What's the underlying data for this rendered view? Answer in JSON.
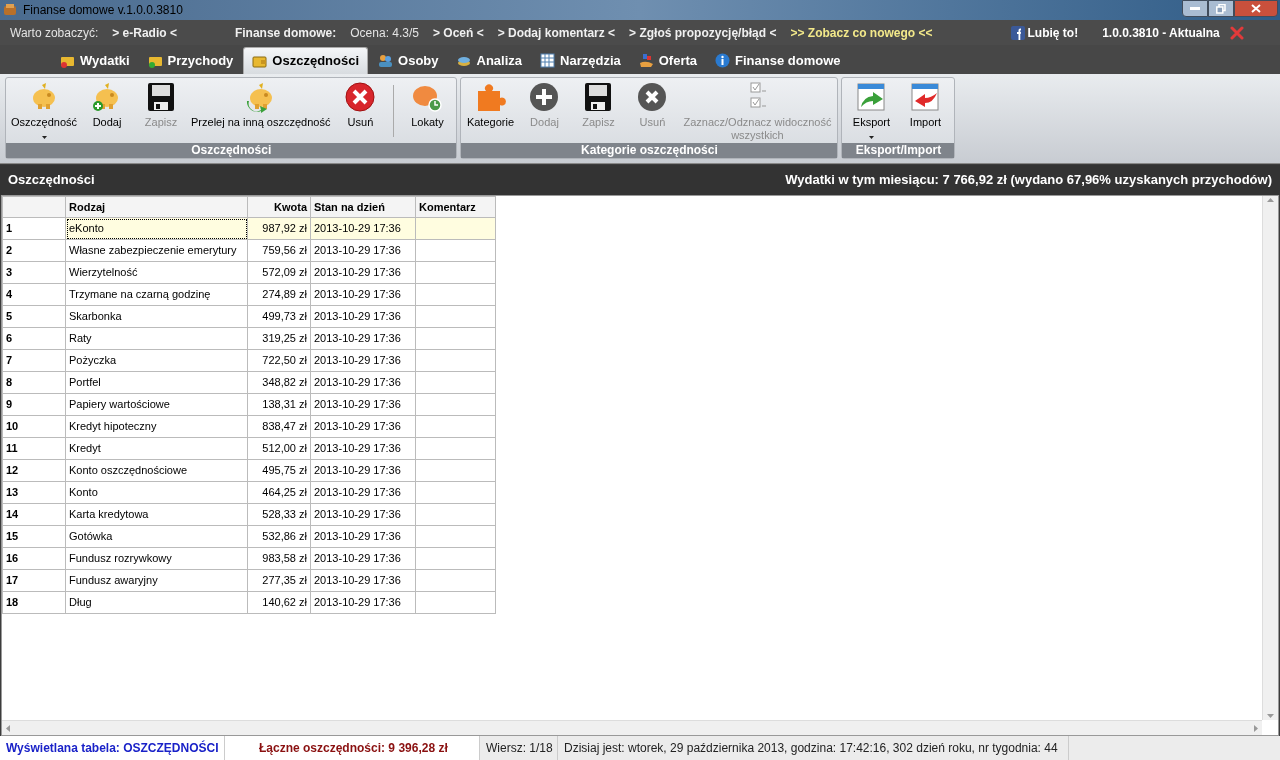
{
  "window": {
    "title": "Finanse domowe v.1.0.0.3810"
  },
  "info_bar": [
    {
      "kind": "label",
      "text": "Warto zobaczyć:"
    },
    {
      "kind": "link",
      "text": "> e-Radio <"
    },
    {
      "kind": "gap"
    },
    {
      "kind": "heading",
      "text": "Finanse domowe:"
    },
    {
      "kind": "label",
      "text": "Ocena: 4.3/5"
    },
    {
      "kind": "link",
      "text": "> Oceń <"
    },
    {
      "kind": "link",
      "text": "> Dodaj komentarz <"
    },
    {
      "kind": "link",
      "text": "> Zgłoś propozycję/błąd <"
    },
    {
      "kind": "highlight",
      "text": ">> Zobacz co nowego <<"
    },
    {
      "kind": "gap"
    },
    {
      "kind": "like",
      "text": "Lubię to!"
    },
    {
      "kind": "version",
      "text": "1.0.0.3810 - Aktualna"
    }
  ],
  "tabs": [
    {
      "label": "Wydatki",
      "selected": false,
      "kind": "wallet-red"
    },
    {
      "label": "Przychody",
      "selected": false,
      "kind": "wallet-green"
    },
    {
      "label": "Oszczędności",
      "selected": true,
      "kind": "wallet"
    },
    {
      "label": "Osoby",
      "selected": false,
      "kind": "people"
    },
    {
      "label": "Analiza",
      "selected": false,
      "kind": "coins"
    },
    {
      "label": "Narzędzia",
      "selected": false,
      "kind": "grid"
    },
    {
      "label": "Oferta",
      "selected": false,
      "kind": "hand"
    },
    {
      "label": "Finanse domowe",
      "selected": false,
      "kind": "info"
    }
  ],
  "ribbon": [
    {
      "title": "Oszczędności",
      "buttons": [
        {
          "label": "Oszczędność",
          "kind": "piggy",
          "disabled": false,
          "dropdown": true
        },
        {
          "label": "Dodaj",
          "kind": "piggy-add",
          "disabled": false,
          "dropdown": false
        },
        {
          "label": "Zapisz",
          "kind": "save",
          "disabled": true,
          "dropdown": false
        },
        {
          "label": "Przelej na inną oszczędność",
          "kind": "piggy-transfer",
          "disabled": false,
          "dropdown": false
        },
        {
          "label": "Usuń",
          "kind": "delete",
          "disabled": false,
          "dropdown": false
        },
        {
          "kind": "separator"
        },
        {
          "label": "Lokaty",
          "kind": "piggy-clock",
          "disabled": false,
          "dropdown": false
        }
      ]
    },
    {
      "title": "Kategorie oszczędności",
      "buttons": [
        {
          "label": "Kategorie",
          "kind": "puzzle",
          "disabled": false,
          "dropdown": false
        },
        {
          "label": "Dodaj",
          "kind": "plus",
          "disabled": true,
          "dropdown": false
        },
        {
          "label": "Zapisz",
          "kind": "save",
          "disabled": true,
          "dropdown": false
        },
        {
          "label": "Usuń",
          "kind": "x",
          "disabled": true,
          "dropdown": false
        },
        {
          "label": "Zaznacz/Odznacz widoczność wszystkich",
          "kind": "checklist",
          "disabled": true,
          "dropdown": false
        }
      ]
    },
    {
      "title": "Eksport/Import",
      "buttons": [
        {
          "label": "Eksport",
          "kind": "export",
          "disabled": false,
          "dropdown": true
        },
        {
          "label": "Import",
          "kind": "import",
          "disabled": false,
          "dropdown": false
        }
      ]
    }
  ],
  "section": {
    "title": "Oszczędności",
    "summary": "Wydatki w tym miesiącu: 7 766,92 zł (wydano 67,96% uzyskanych przychodów)"
  },
  "table": {
    "columns": [
      "Rodzaj",
      "Kwota",
      "Stan na dzień",
      "Komentarz"
    ],
    "rows": [
      {
        "number": "1",
        "cells": [
          "eKonto",
          "987,92 zł",
          "2013-10-29 17:36"
        ],
        "selected": true
      },
      {
        "number": "2",
        "cells": [
          "Własne zabezpieczenie emerytury",
          "759,56 zł",
          "2013-10-29 17:36"
        ],
        "selected": false
      },
      {
        "number": "3",
        "cells": [
          "Wierzytelność",
          "572,09 zł",
          "2013-10-29 17:36"
        ],
        "selected": false
      },
      {
        "number": "4",
        "cells": [
          "Trzymane na czarną godzinę",
          "274,89 zł",
          "2013-10-29 17:36"
        ],
        "selected": false
      },
      {
        "number": "5",
        "cells": [
          "Skarbonka",
          "499,73 zł",
          "2013-10-29 17:36"
        ],
        "selected": false
      },
      {
        "number": "6",
        "cells": [
          "Raty",
          "319,25 zł",
          "2013-10-29 17:36"
        ],
        "selected": false
      },
      {
        "number": "7",
        "cells": [
          "Pożyczka",
          "722,50 zł",
          "2013-10-29 17:36"
        ],
        "selected": false
      },
      {
        "number": "8",
        "cells": [
          "Portfel",
          "348,82 zł",
          "2013-10-29 17:36"
        ],
        "selected": false
      },
      {
        "number": "9",
        "cells": [
          "Papiery wartościowe",
          "138,31 zł",
          "2013-10-29 17:36"
        ],
        "selected": false
      },
      {
        "number": "10",
        "cells": [
          "Kredyt hipoteczny",
          "838,47 zł",
          "2013-10-29 17:36"
        ],
        "selected": false
      },
      {
        "number": "11",
        "cells": [
          "Kredyt",
          "512,00 zł",
          "2013-10-29 17:36"
        ],
        "selected": false
      },
      {
        "number": "12",
        "cells": [
          "Konto oszczędnościowe",
          "495,75 zł",
          "2013-10-29 17:36"
        ],
        "selected": false
      },
      {
        "number": "13",
        "cells": [
          "Konto",
          "464,25 zł",
          "2013-10-29 17:36"
        ],
        "selected": false
      },
      {
        "number": "14",
        "cells": [
          "Karta kredytowa",
          "528,33 zł",
          "2013-10-29 17:36"
        ],
        "selected": false
      },
      {
        "number": "15",
        "cells": [
          "Gotówka",
          "532,86 zł",
          "2013-10-29 17:36"
        ],
        "selected": false
      },
      {
        "number": "16",
        "cells": [
          "Fundusz rozrywkowy",
          "983,58 zł",
          "2013-10-29 17:36"
        ],
        "selected": false
      },
      {
        "number": "17",
        "cells": [
          "Fundusz awaryjny",
          "277,35 zł",
          "2013-10-29 17:36"
        ],
        "selected": false
      },
      {
        "number": "18",
        "cells": [
          "Dług",
          "140,62 zł",
          "2013-10-29 17:36"
        ],
        "selected": false
      }
    ]
  },
  "status_bar": [
    {
      "kind": "table",
      "text": "Wyświetlana tabela: OSZCZĘDNOŚCI"
    },
    {
      "kind": "total",
      "text": "Łączne oszczędności: 9 396,28 zł"
    },
    {
      "kind": "plain",
      "text": "Wiersz: 1/18"
    },
    {
      "kind": "wide",
      "text": "Dzisiaj jest: wtorek,  29 października 2013, godzina: 17:42:16, 302 dzień roku, nr tygodnia: 44"
    }
  ]
}
